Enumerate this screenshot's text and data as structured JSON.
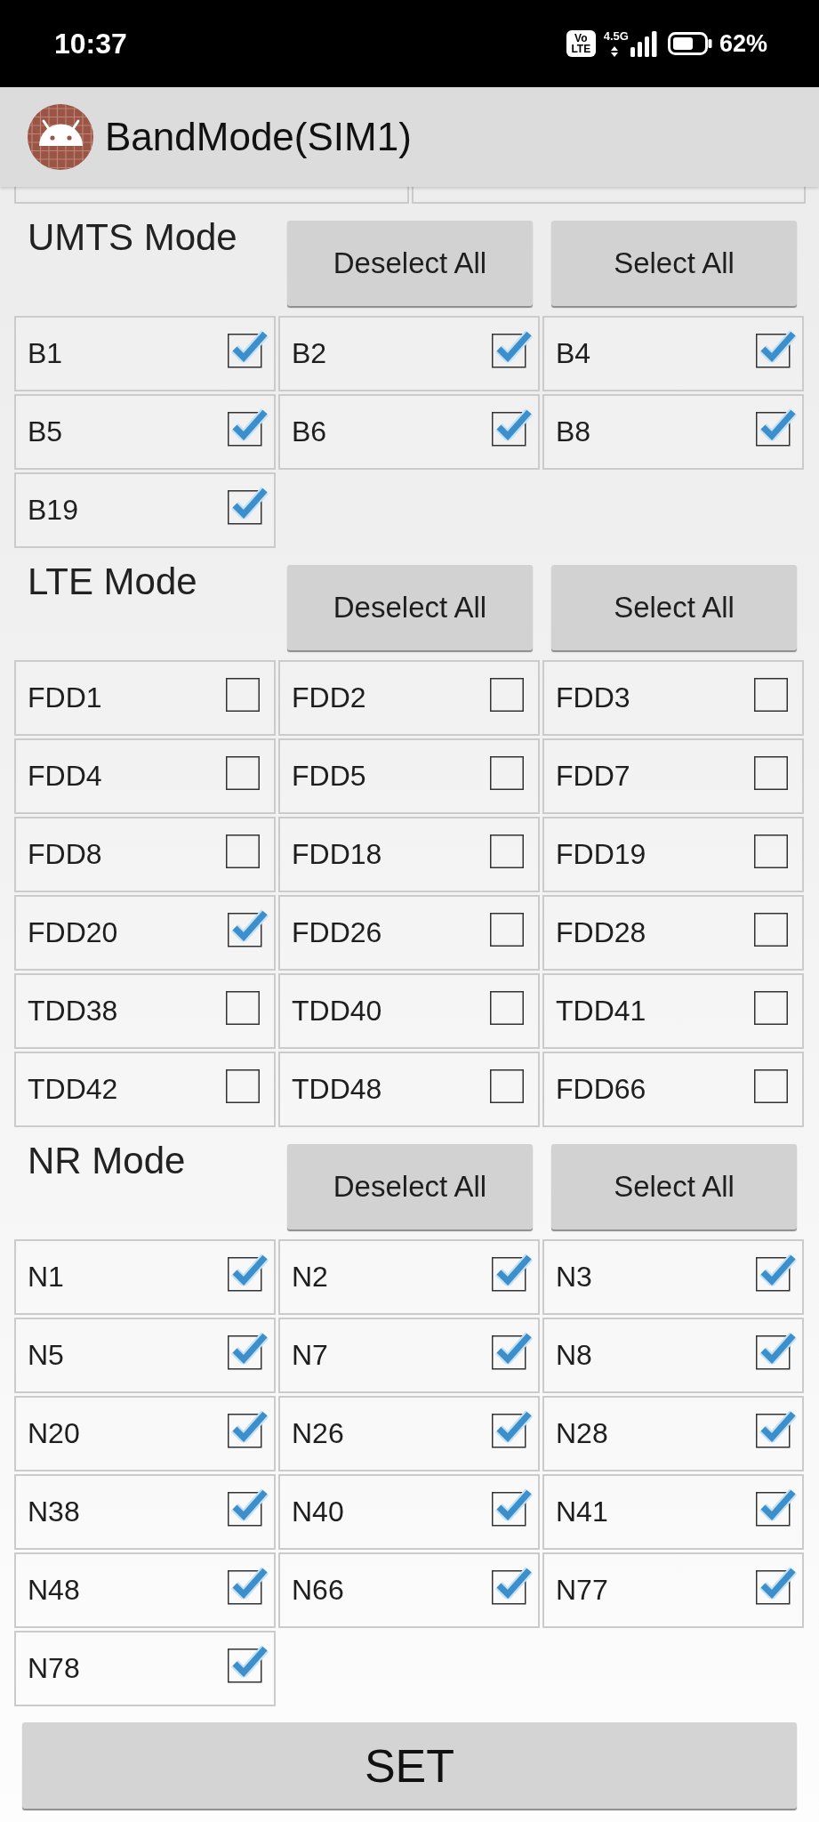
{
  "status_bar": {
    "time": "10:37",
    "volte_badge": [
      "Vo",
      "LTE"
    ],
    "network_type": "4.5G",
    "battery": "62%"
  },
  "app_bar": {
    "title": "BandMode(SIM1)"
  },
  "sections": [
    {
      "title": "UMTS Mode",
      "buttons": [
        "Deselect All",
        "Select All"
      ],
      "bands": [
        {
          "label": "B1",
          "checked": true
        },
        {
          "label": "B2",
          "checked": true
        },
        {
          "label": "B4",
          "checked": true
        },
        {
          "label": "B5",
          "checked": true
        },
        {
          "label": "B6",
          "checked": true
        },
        {
          "label": "B8",
          "checked": true
        },
        {
          "label": "B19",
          "checked": true
        }
      ]
    },
    {
      "title": "LTE Mode",
      "buttons": [
        "Deselect All",
        "Select All"
      ],
      "bands": [
        {
          "label": "FDD1",
          "checked": false
        },
        {
          "label": "FDD2",
          "checked": false
        },
        {
          "label": "FDD3",
          "checked": false
        },
        {
          "label": "FDD4",
          "checked": false
        },
        {
          "label": "FDD5",
          "checked": false
        },
        {
          "label": "FDD7",
          "checked": false
        },
        {
          "label": "FDD8",
          "checked": false
        },
        {
          "label": "FDD18",
          "checked": false
        },
        {
          "label": "FDD19",
          "checked": false
        },
        {
          "label": "FDD20",
          "checked": true
        },
        {
          "label": "FDD26",
          "checked": false
        },
        {
          "label": "FDD28",
          "checked": false
        },
        {
          "label": "TDD38",
          "checked": false
        },
        {
          "label": "TDD40",
          "checked": false
        },
        {
          "label": "TDD41",
          "checked": false
        },
        {
          "label": "TDD42",
          "checked": false
        },
        {
          "label": "TDD48",
          "checked": false
        },
        {
          "label": "FDD66",
          "checked": false
        }
      ]
    },
    {
      "title": "NR Mode",
      "buttons": [
        "Deselect All",
        "Select All"
      ],
      "bands": [
        {
          "label": "N1",
          "checked": true
        },
        {
          "label": "N2",
          "checked": true
        },
        {
          "label": "N3",
          "checked": true
        },
        {
          "label": "N5",
          "checked": true
        },
        {
          "label": "N7",
          "checked": true
        },
        {
          "label": "N8",
          "checked": true
        },
        {
          "label": "N20",
          "checked": true
        },
        {
          "label": "N26",
          "checked": true
        },
        {
          "label": "N28",
          "checked": true
        },
        {
          "label": "N38",
          "checked": true
        },
        {
          "label": "N40",
          "checked": true
        },
        {
          "label": "N41",
          "checked": true
        },
        {
          "label": "N48",
          "checked": true
        },
        {
          "label": "N66",
          "checked": true
        },
        {
          "label": "N77",
          "checked": true
        },
        {
          "label": "N78",
          "checked": true
        }
      ]
    }
  ],
  "set_button": "SET"
}
